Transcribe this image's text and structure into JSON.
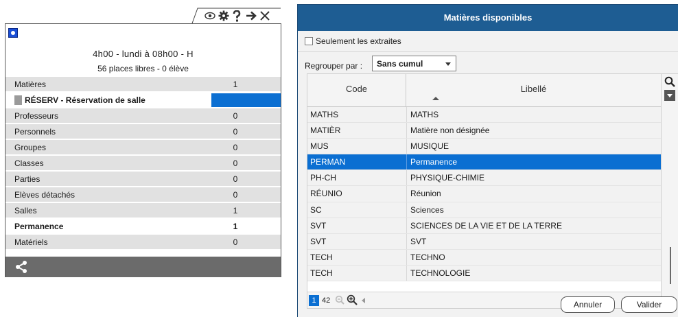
{
  "left_panel": {
    "course_time": "4h00  -  lundi à 08h00  -  H",
    "course_places": "56 places libres  -  0 élève",
    "rows": [
      {
        "label": "Matières",
        "value": "1"
      },
      {
        "label": "RÉSERV - Réservation de salle",
        "value": ""
      },
      {
        "label": "Professeurs",
        "value": "0"
      },
      {
        "label": "Personnels",
        "value": "0"
      },
      {
        "label": "Groupes",
        "value": "0"
      },
      {
        "label": "Classes",
        "value": "0"
      },
      {
        "label": "Parties",
        "value": "0"
      },
      {
        "label": "Elèves détachés",
        "value": "0"
      },
      {
        "label": "Salles",
        "value": "1"
      },
      {
        "label": "Permanence",
        "value": "1"
      },
      {
        "label": "Matériels",
        "value": "0"
      }
    ],
    "colors": {
      "course_marker": "#1a4fd6",
      "reservation_swatch": "#0b6fd2",
      "footer": "#6b6b6b"
    },
    "icons": [
      "eye-icon",
      "gear-icon",
      "help-icon",
      "arrow-right-icon",
      "close-icon",
      "share-icon"
    ]
  },
  "dialog": {
    "title": "Matières disponibles",
    "only_extracted_label": "Seulement les extraites",
    "only_extracted_checked": false,
    "group_by_label": "Regrouper par :",
    "group_by_value": "Sans cumul",
    "columns": {
      "code": "Code",
      "libelle": "Libellé"
    },
    "rows": [
      {
        "code": "MATHS",
        "libelle": "MATHS"
      },
      {
        "code": "MATIÈR",
        "libelle": "Matière non désignée"
      },
      {
        "code": "MUS",
        "libelle": "MUSIQUE"
      },
      {
        "code": "PERMAN",
        "libelle": "Permanence"
      },
      {
        "code": "PH-CH",
        "libelle": "PHYSIQUE-CHIMIE"
      },
      {
        "code": "RÉUNIO",
        "libelle": "Réunion"
      },
      {
        "code": "SC",
        "libelle": "Sciences"
      },
      {
        "code": "SVT",
        "libelle": "SCIENCES DE LA VIE ET DE LA TERRE"
      },
      {
        "code": "SVT",
        "libelle": "SVT"
      },
      {
        "code": "TECH",
        "libelle": "TECHNO"
      },
      {
        "code": "TECH",
        "libelle": "TECHNOLOGIE"
      }
    ],
    "selected_row_index": 3,
    "pagination": {
      "current": "1",
      "total": "42"
    },
    "buttons": {
      "cancel": "Annuler",
      "validate": "Valider"
    },
    "colors": {
      "title_bar": "#1e5d93",
      "selection": "#0b6fd2"
    }
  }
}
